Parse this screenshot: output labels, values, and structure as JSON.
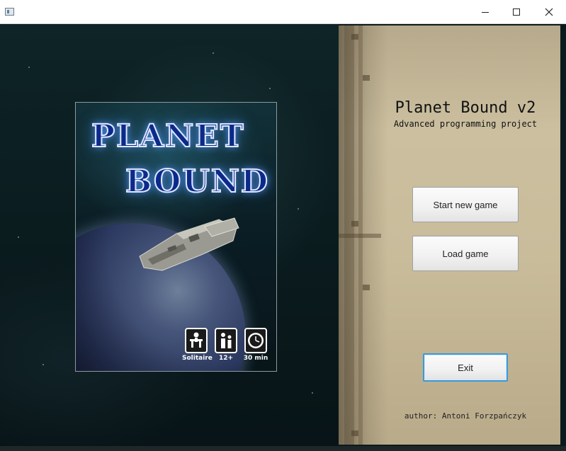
{
  "window": {
    "icon": "app-window-icon",
    "controls": {
      "minimize": "minimize-icon",
      "maximize": "maximize-icon",
      "close": "close-icon"
    }
  },
  "cover": {
    "logo_line1": "PLANET",
    "logo_line2": "BOUND",
    "badges": [
      {
        "icon": "solitaire-icon",
        "label": "Solitaire"
      },
      {
        "icon": "age-icon",
        "label": "12+"
      },
      {
        "icon": "clock-icon",
        "label": "30 min"
      }
    ]
  },
  "menu": {
    "title": "Planet Bound v2",
    "subtitle": "Advanced programming project",
    "start_label": "Start new game",
    "load_label": "Load game",
    "exit_label": "Exit",
    "author": "author: Antoni Forzpańczyk"
  },
  "colors": {
    "exit_focus_border": "#3a9ad9",
    "panel_base": "#c9bc9b",
    "space_bg": "#0b1a1c"
  }
}
